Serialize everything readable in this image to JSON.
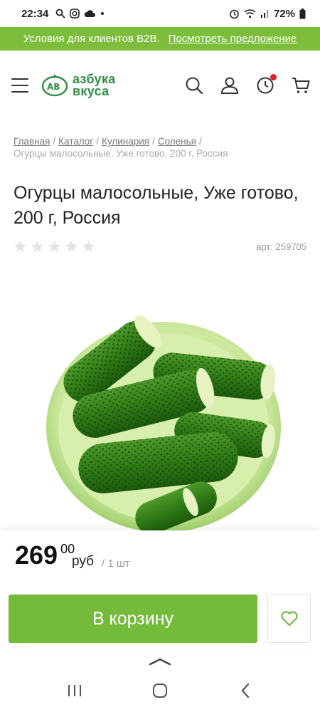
{
  "status_bar": {
    "time": "22:34",
    "battery": "72%",
    "icons": [
      "search-icon",
      "instagram-icon",
      "cloud-icon",
      "dot-icon",
      "alarm-icon",
      "wifi-icon",
      "signal-icon",
      "battery-icon"
    ]
  },
  "promo": {
    "text": "Условия для клиентов B2B.",
    "link": "Посмотреть предложение",
    "color": "#7cbe3c"
  },
  "header": {
    "logo_line1": "азбука",
    "logo_line2": "вкуса",
    "brand_color": "#2f8f46",
    "icons": [
      "menu-icon",
      "search-icon",
      "user-icon",
      "recent-icon",
      "cart-icon"
    ],
    "notification_color": "#e0202a"
  },
  "breadcrumb": {
    "items": [
      "Главная",
      "Каталог",
      "Кулинария",
      "Соленья"
    ],
    "separator": "/",
    "current": "Огурцы малосольные, Уже готово, 200 г, Россия"
  },
  "product": {
    "title": "Огурцы малосольные, Уже готово, 200 г, Россия",
    "article": "арт: 259705",
    "rating_stars": 5,
    "rating_value": 0,
    "image_subject": "pickled cucumbers in green bowl"
  },
  "price": {
    "integer": "269",
    "fraction": "00",
    "currency": "руб",
    "unit": "/ 1 шт"
  },
  "actions": {
    "cart_label": "В корзину",
    "cart_color": "#74bb3b",
    "favorite_icon": "heart-icon"
  },
  "navigation": {
    "icons": [
      "recent-apps-icon",
      "home-icon",
      "back-icon"
    ]
  }
}
